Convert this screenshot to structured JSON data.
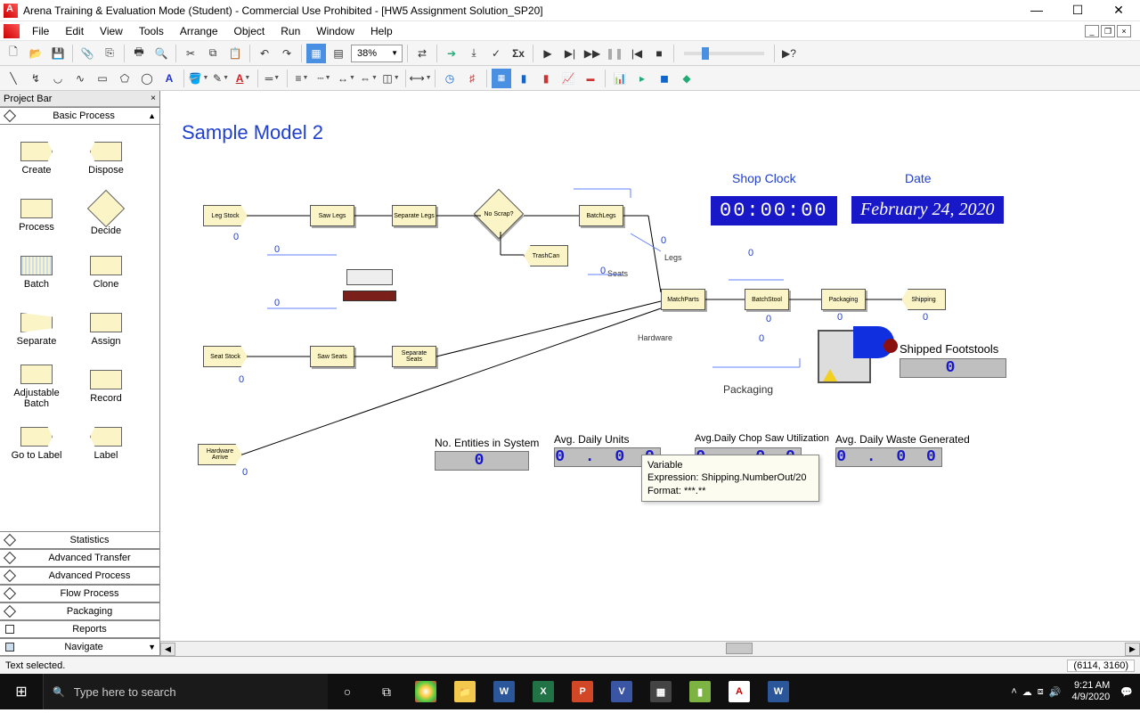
{
  "window": {
    "title": "Arena Training & Evaluation Mode (Student) - Commercial Use Prohibited - [HW5 Assignment Solution_SP20]"
  },
  "menu": [
    "File",
    "Edit",
    "View",
    "Tools",
    "Arrange",
    "Object",
    "Run",
    "Window",
    "Help"
  ],
  "zoom": "38%",
  "projectbar": {
    "title": "Project Bar",
    "active_category": "Basic Process",
    "items": [
      "Create",
      "Dispose",
      "Process",
      "Decide",
      "Batch",
      "Clone",
      "Separate",
      "Assign",
      "Adjustable Batch",
      "Record",
      "Go to Label",
      "Label"
    ],
    "categories": [
      "Statistics",
      "Advanced Transfer",
      "Advanced Process",
      "Flow Process",
      "Packaging",
      "Reports",
      "Navigate"
    ]
  },
  "model": {
    "title": "Sample Model 2",
    "clock_label": "Shop Clock",
    "clock_value": "00:00:00",
    "date_label": "Date",
    "date_value": "February 24, 2020",
    "modules": {
      "leg_stock": "Leg Stock",
      "saw_legs": "Saw Legs",
      "separate_legs": "Separate Legs",
      "no_scrap": "No Scrap?",
      "batch_legs": "BatchLegs",
      "trashcan": "TrashCan",
      "seat_stock": "Seat Stock",
      "saw_seats": "Saw Seats",
      "separate_seats": "Separate Seats",
      "hardware_arrive": "Hardware Arrive",
      "match_parts": "MatchParts",
      "batch_stool": "BatchStool",
      "packaging": "Packaging",
      "shipping": "Shipping"
    },
    "labels": {
      "legs": "Legs",
      "seats": "Seats",
      "hardware": "Hardware",
      "packaging_txt": "Packaging",
      "shipped": "Shipped Footstools"
    },
    "stats": {
      "entities_label": "No. Entities in System",
      "entities_val": "0",
      "daily_units_label": "Avg. Daily Units",
      "daily_units_val": "0 . 0 0",
      "chopsaw_label": "Avg.Daily Chop Saw Utilization",
      "chopsaw_val": "0 . 0 0",
      "waste_label": "Avg. Daily Waste Generated",
      "waste_val": "0 . 0 0",
      "shipped_val": "0"
    },
    "counter_zero": "0"
  },
  "tooltip": {
    "line1": "Variable",
    "line2": "Expression: Shipping.NumberOut/20",
    "line3": "Format: ***.**"
  },
  "status": {
    "text": "Text selected.",
    "coords": "(6114, 3160)"
  },
  "taskbar": {
    "search_placeholder": "Type here to search",
    "time": "9:21 AM",
    "date": "4/9/2020"
  }
}
